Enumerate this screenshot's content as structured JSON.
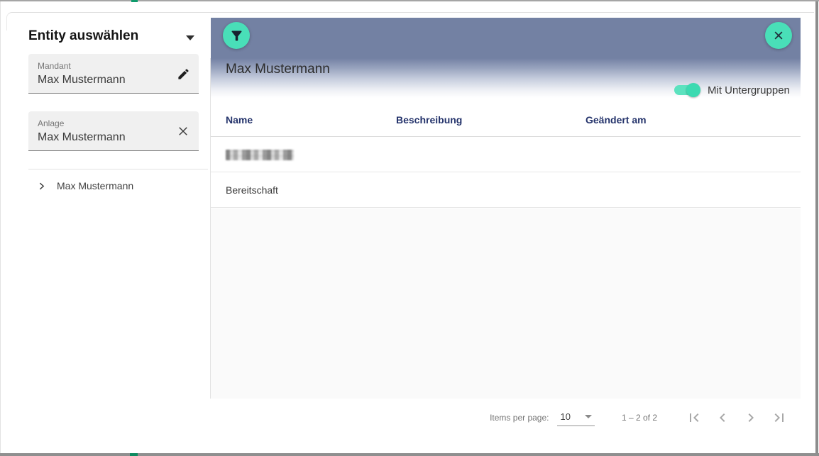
{
  "window": {
    "frame_color": "#8f8f8f",
    "accent_green": "#0f9b6c"
  },
  "sidebar": {
    "title": "Entity auswählen",
    "mandant": {
      "label": "Mandant",
      "value": "Max Mustermann"
    },
    "anlage": {
      "label": "Anlage",
      "value": "Max Mustermann"
    },
    "tree_item": "Max Mustermann"
  },
  "panel": {
    "title": "Max Mustermann",
    "toggle": {
      "label": "Mit Untergruppen",
      "state": "on"
    },
    "table": {
      "columns": [
        "Name",
        "Beschreibung",
        "Geändert am"
      ],
      "rows": [
        {
          "name": "",
          "redacted": true
        },
        {
          "name": "Bereitschaft",
          "redacted": false
        }
      ]
    },
    "paginator": {
      "items_per_page_label": "Items per page:",
      "page_size": "10",
      "range": "1 – 2 of 2"
    }
  },
  "icons": {
    "sidebar_title": "caret-down",
    "mandant_field": "edit-pencil",
    "anlage_field": "clear-x",
    "tree": "chevron-right",
    "toolbar_left": "filter-funnel",
    "toolbar_right": "close-x",
    "paginator": [
      "first-page",
      "previous-page",
      "next-page",
      "last-page"
    ]
  },
  "colors": {
    "toolbar": "#7381a3",
    "accent_teal": "#49dfb8",
    "table_header_text": "#24336b",
    "field_background": "#f0f0f0"
  }
}
